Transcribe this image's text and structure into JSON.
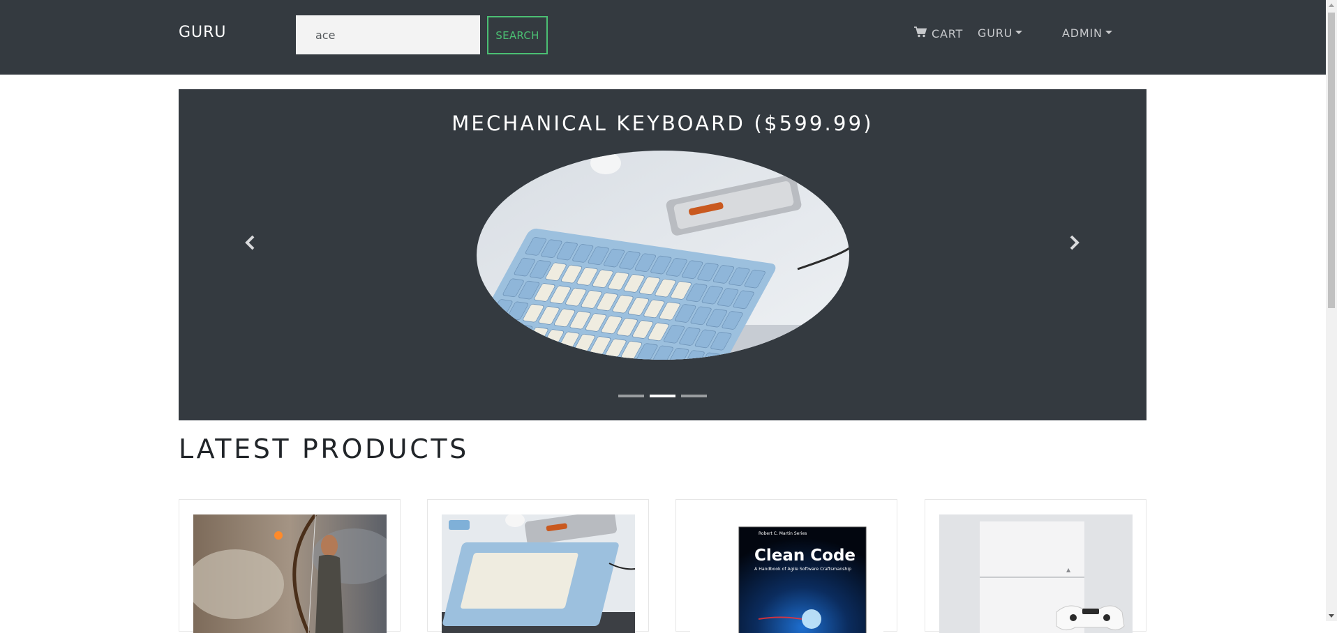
{
  "navbar": {
    "brand": "GURU",
    "search": {
      "value": "ace",
      "button_label": "SEARCH"
    },
    "links": {
      "cart": "CART",
      "user_menu": "GURU",
      "admin_menu": "ADMIN"
    }
  },
  "carousel": {
    "caption": "MECHANICAL KEYBOARD ($599.99)",
    "slide_count": 3,
    "active_index": 1
  },
  "latest": {
    "title": "LATEST PRODUCTS",
    "products": [
      {
        "image": "archer-game-cover"
      },
      {
        "image": "mechanical-keyboard"
      },
      {
        "image": "clean-code-book",
        "cover_series": "Robert C. Martin Series",
        "cover_title": "Clean Code",
        "cover_subtitle": "A Handbook of Agile Software Craftsmanship"
      },
      {
        "image": "white-game-console"
      }
    ]
  },
  "colors": {
    "navbar": "#343a40",
    "accent": "#4bbf73",
    "keycap_blue": "#8fb6d9",
    "keycap_cream": "#efece0"
  }
}
